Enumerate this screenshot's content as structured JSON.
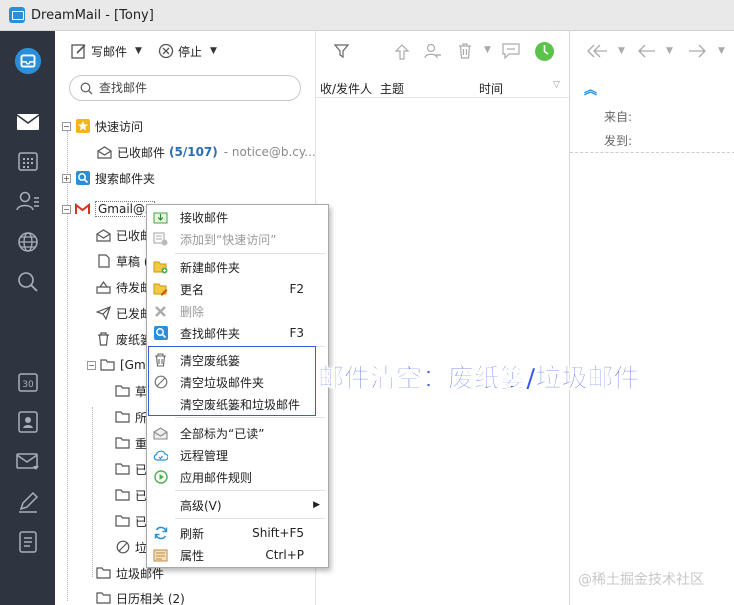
{
  "window": {
    "title": "DreamMail - [Tony]"
  },
  "toolbar": {
    "compose_label": "写邮件",
    "stop_label": "停止"
  },
  "search": {
    "placeholder": "查找邮件"
  },
  "tree": {
    "quick_access": "快速访问",
    "inbox": {
      "label": "已收邮件",
      "count": "(5/107)",
      "sub": "- notice@b.cy..."
    },
    "search_folder": "搜索邮件夹",
    "gmail": "Gmail@x",
    "gmail_children": [
      "已收邮",
      "草稿 (",
      "待发邮",
      "已发邮",
      "废纸篓"
    ],
    "gma_folder": "[Gma",
    "gma_children": [
      "草",
      "所",
      "重",
      "已",
      "已",
      "已",
      "垃"
    ],
    "junk": "垃圾邮件",
    "calendar": "日历相关 (2)"
  },
  "list": {
    "columns": {
      "sender": "收/发件人",
      "subject": "主题",
      "time": "时间"
    },
    "empty_hint": "件"
  },
  "reading": {
    "from_label": "来自:",
    "to_label": "发到:"
  },
  "context_menu": {
    "items": [
      {
        "label": "接收邮件",
        "shortcut": "",
        "disabled": false
      },
      {
        "label": "添加到“快速访问”",
        "shortcut": "",
        "disabled": true
      },
      {
        "label": "新建邮件夹",
        "shortcut": "",
        "disabled": false
      },
      {
        "label": "更名",
        "shortcut": "F2",
        "disabled": false
      },
      {
        "label": "删除",
        "shortcut": "",
        "disabled": true
      },
      {
        "label": "查找邮件夹",
        "shortcut": "F3",
        "disabled": false
      },
      {
        "label": "清空废纸篓",
        "shortcut": "",
        "disabled": false
      },
      {
        "label": "清空垃圾邮件夹",
        "shortcut": "",
        "disabled": false
      },
      {
        "label": "清空废纸篓和垃圾邮件",
        "shortcut": "",
        "disabled": false
      },
      {
        "label": "全部标为“已读”",
        "shortcut": "",
        "disabled": false
      },
      {
        "label": "远程管理",
        "shortcut": "",
        "disabled": false
      },
      {
        "label": "应用邮件规则",
        "shortcut": "",
        "disabled": false
      },
      {
        "label": "高级(V)",
        "shortcut": "",
        "disabled": false
      },
      {
        "label": "刷新",
        "shortcut": "Shift+F5",
        "disabled": false
      },
      {
        "label": "属性",
        "shortcut": "Ctrl+P",
        "disabled": false
      }
    ]
  },
  "annotation": {
    "text": "邮件清空：废纸篓/垃圾邮件"
  },
  "watermark": {
    "text": "@稀土掘金技术社区"
  },
  "colors": {
    "rail_bg": "#2f3540",
    "accent_blue": "#2a8fd8",
    "annotation_blue": "#3b57e8",
    "count_blue": "#2a6db3",
    "online_green": "#5cc34a"
  }
}
